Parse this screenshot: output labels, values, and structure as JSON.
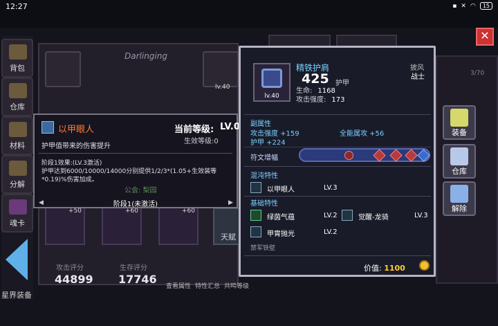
{
  "status": {
    "time": "12:27",
    "battery": "15"
  },
  "nav": [
    {
      "label": "背包"
    },
    {
      "label": "仓库"
    },
    {
      "label": "材料"
    },
    {
      "label": "分解"
    },
    {
      "label": "魂卡"
    }
  ],
  "bottom_left_label": "星界装备",
  "character": {
    "name": "Darlinging",
    "guild": "公会: 梨园"
  },
  "scores": {
    "attack_label": "攻击评分",
    "attack": "44899",
    "survive_label": "生存评分",
    "survive": "17746"
  },
  "bottom_actions": [
    "查看属性",
    "特性汇总",
    "共鸣等级"
  ],
  "talent_label": "天赋",
  "equip_levels": [
    "lv.40",
    "lv.40",
    "lv.40"
  ],
  "equip_plus": [
    "+50",
    "+60",
    "+60"
  ],
  "page_counter": "3/70",
  "trait_tooltip": {
    "name": "以甲眼人",
    "level_label": "当前等级:",
    "level_value": "LV.0",
    "effective_level": "生效等级:0",
    "description": "护甲值带来的伤害提升",
    "stage_effect": "阶段1效果:(LV.3激活)",
    "stage_detail": "护甲达到6000/10000/14000分别提供1/2/3*(1.05+生效装等*0.19)%伤害加成。",
    "footer": "阶段1(未激活)",
    "prev_arrow": "◀",
    "next_arrow": "▶"
  },
  "item": {
    "name": "精铁护肩",
    "value": "425",
    "value_unit": "护甲",
    "level": "lv.40",
    "type": "披风",
    "class": "战士",
    "stats": [
      {
        "label": "生命:",
        "value": "1168"
      },
      {
        "label": "攻击强度:",
        "value": "173"
      }
    ],
    "sub_attr_title": "副属性",
    "sub_attrs": [
      "攻击强度 +159",
      "全能属攻 +56",
      "护甲 +224"
    ],
    "rune_title": "符文增幅",
    "chaos_title": "混沌特性",
    "chaos_traits": [
      {
        "name": "以甲眼人",
        "level": "LV.3"
      }
    ],
    "base_title": "基础特性",
    "base_traits": [
      {
        "name": "绿茵气蕴",
        "level": "LV.2"
      },
      {
        "name": "觉醒-龙骑",
        "level": "LV.3"
      },
      {
        "name": "甲胄抛光",
        "level": "LV.2"
      }
    ],
    "set_name": "禁军铁壁",
    "price_label": "价值:",
    "price": "1100"
  },
  "side_buttons": [
    "装备",
    "仓库",
    "解除"
  ],
  "close_symbol": "✕",
  "colors": {
    "accent_blue": "#7ad0ff",
    "level_red": "#ff5a3a",
    "gold": "#ffcc33",
    "trait_orange": "#ff7a3a"
  }
}
